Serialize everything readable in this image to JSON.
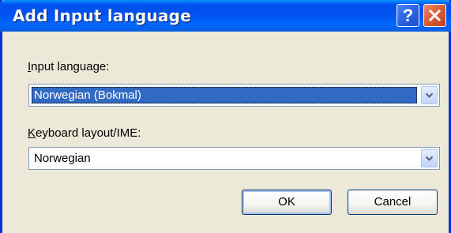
{
  "window": {
    "title": "Add Input language",
    "help_glyph": "?"
  },
  "input_language": {
    "label_accel": "I",
    "label_rest": "nput language:",
    "value": "Norwegian (Bokmal)"
  },
  "keyboard_layout": {
    "label_accel": "K",
    "label_rest": "eyboard layout/IME:",
    "value": "Norwegian"
  },
  "buttons": {
    "ok": "OK",
    "cancel": "Cancel"
  },
  "colors": {
    "titlebar": "#0054e3",
    "close": "#d95f36",
    "selection": "#316ac5",
    "face": "#ece9d8"
  },
  "icons": {
    "help": "help-icon",
    "close": "close-icon",
    "dropdown": "chevron-down-icon"
  }
}
